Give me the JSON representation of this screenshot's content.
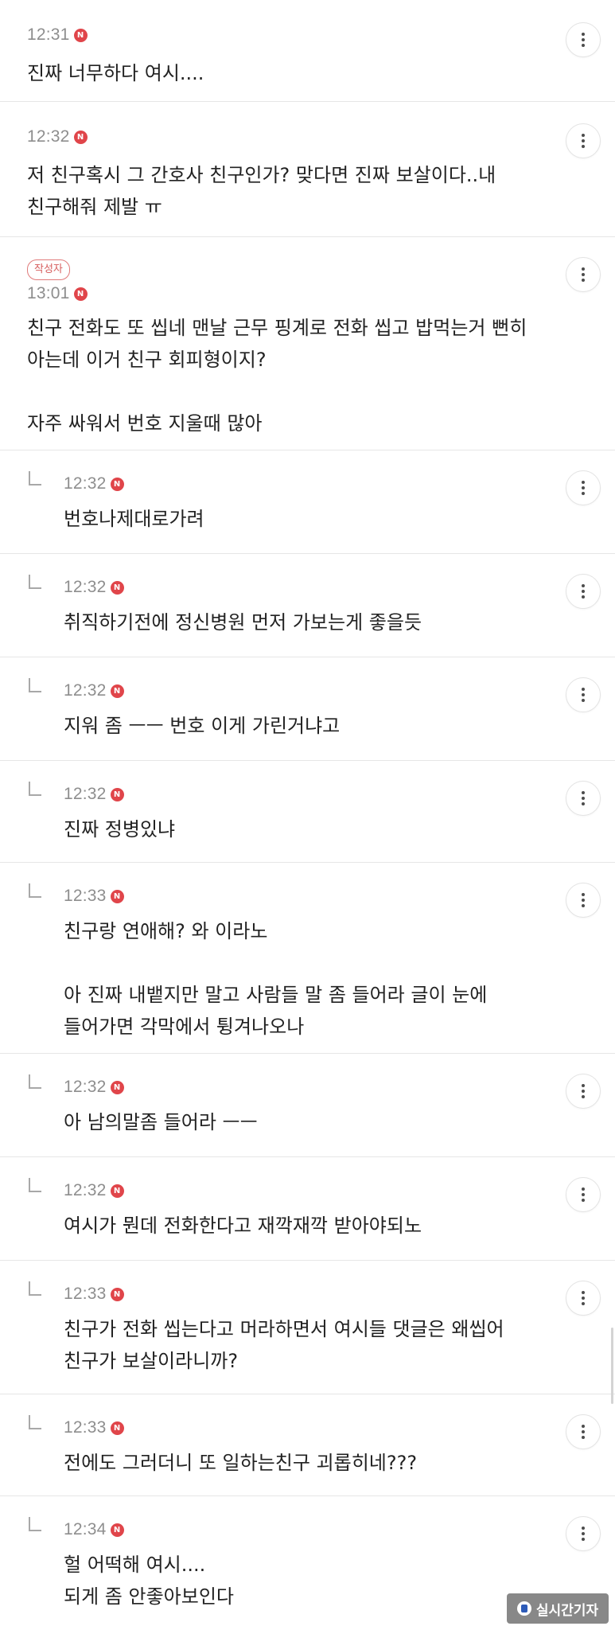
{
  "comments": [
    {
      "time": "12:31",
      "new": "N",
      "text": "진짜 너무하다 여시...."
    },
    {
      "time": "12:32",
      "new": "N",
      "text": "저 친구혹시 그 간호사 친구인가? 맞다면 진짜 보살이다..내\n친구해줘 제발 ㅠ"
    },
    {
      "badge": "작성자",
      "time": "13:01",
      "new": "N",
      "text": "친구 전화도 또 씹네 맨날 근무 핑계로 전화 씹고 밥먹는거 뻔히\n아는데 이거 친구 회피형이지?\n\n자주 싸워서 번호 지울때 많아"
    },
    {
      "time": "12:32",
      "new": "N",
      "text": "번호나제대로가려"
    },
    {
      "time": "12:32",
      "new": "N",
      "text": "취직하기전에 정신병원 먼저 가보는게 좋을듯"
    },
    {
      "time": "12:32",
      "new": "N",
      "text": "지워 좀 ㅡㅡ 번호 이게 가린거냐고"
    },
    {
      "time": "12:32",
      "new": "N",
      "text": "진짜 정병있냐"
    },
    {
      "time": "12:33",
      "new": "N",
      "text": "친구랑 연애해? 와 이라노\n\n아 진짜 내뱉지만 말고 사람들 말 좀 들어라 글이 눈에\n들어가면 각막에서 튕겨나오나"
    },
    {
      "time": "12:32",
      "new": "N",
      "text": "아 남의말좀 들어라 ㅡㅡ"
    },
    {
      "time": "12:32",
      "new": "N",
      "text": "여시가 뭔데 전화한다고 재깍재깍 받아야되노"
    },
    {
      "time": "12:33",
      "new": "N",
      "text": "친구가 전화 씹는다고 머라하면서 여시들 댓글은 왜씹어\n친구가 보살이라니까?"
    },
    {
      "time": "12:33",
      "new": "N",
      "text": "전에도 그러더니 또 일하는친구 괴롭히네???"
    },
    {
      "time": "12:34",
      "new": "N",
      "text": "헐 어떡해 여시....\n되게 좀 안좋아보인다"
    }
  ],
  "watermark": {
    "text": "실시간기자"
  },
  "icons": {
    "more": "more-vertical-icon",
    "reply": "reply-arrow-icon",
    "new": "new-badge-icon"
  }
}
